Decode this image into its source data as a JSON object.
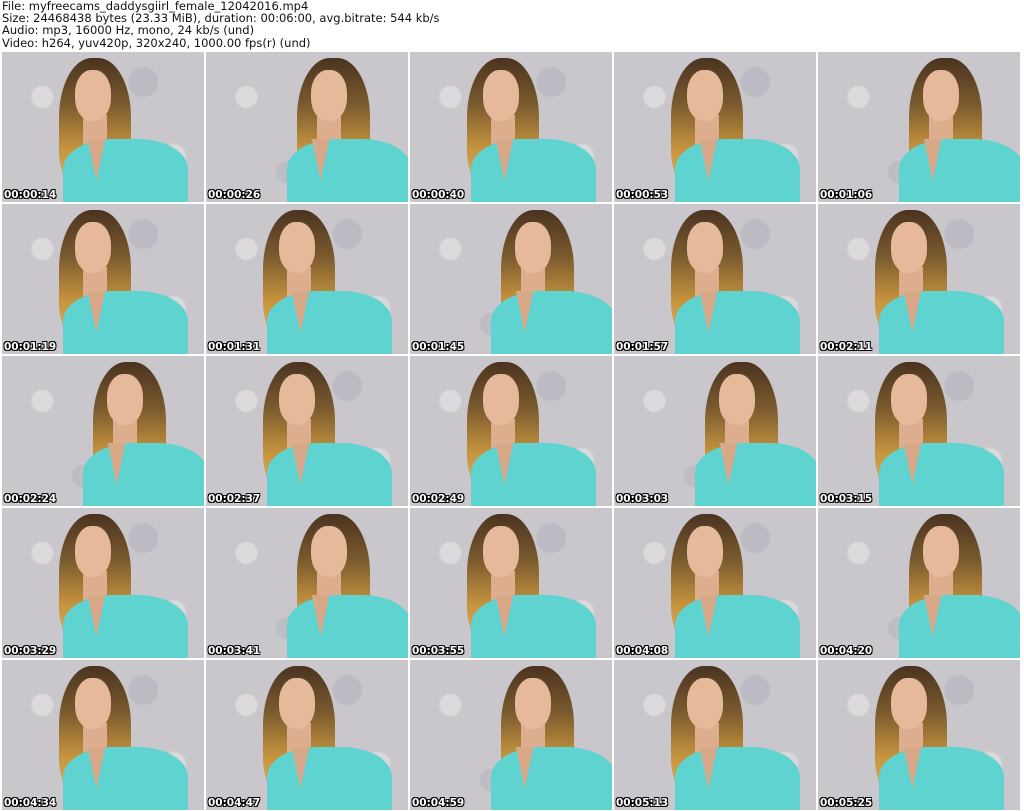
{
  "header": {
    "file": "File: myfreecams_daddysgiirl_female_12042016.mp4",
    "size": "Size: 24468438 bytes (23.33 MiB), duration: 00:06:00, avg.bitrate: 544 kb/s",
    "audio": "Audio: mp3, 16000 Hz, mono, 24 kb/s (und)",
    "video": "Video: h264, yuv420p, 320x240, 1000.00 fps(r) (und)"
  },
  "thumbnails": [
    {
      "timestamp": "00:00:14"
    },
    {
      "timestamp": "00:00:26"
    },
    {
      "timestamp": "00:00:40"
    },
    {
      "timestamp": "00:00:53"
    },
    {
      "timestamp": "00:01:06"
    },
    {
      "timestamp": "00:01:19"
    },
    {
      "timestamp": "00:01:31"
    },
    {
      "timestamp": "00:01:45"
    },
    {
      "timestamp": "00:01:57"
    },
    {
      "timestamp": "00:02:11"
    },
    {
      "timestamp": "00:02:24"
    },
    {
      "timestamp": "00:02:37"
    },
    {
      "timestamp": "00:02:49"
    },
    {
      "timestamp": "00:03:03"
    },
    {
      "timestamp": "00:03:15"
    },
    {
      "timestamp": "00:03:29"
    },
    {
      "timestamp": "00:03:41"
    },
    {
      "timestamp": "00:03:55"
    },
    {
      "timestamp": "00:04:08"
    },
    {
      "timestamp": "00:04:20"
    },
    {
      "timestamp": "00:04:34"
    },
    {
      "timestamp": "00:04:47"
    },
    {
      "timestamp": "00:04:59"
    },
    {
      "timestamp": "00:05:13"
    },
    {
      "timestamp": "00:05:25"
    }
  ]
}
